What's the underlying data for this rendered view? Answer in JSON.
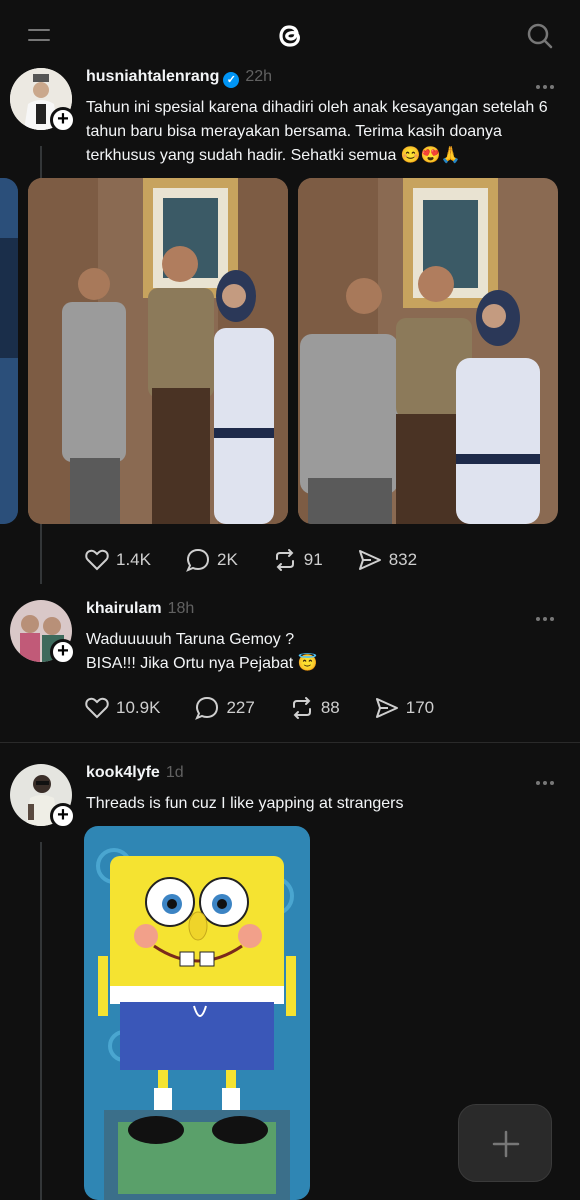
{
  "header": {
    "menu_icon": "menu-icon",
    "logo_icon": "threads-logo-icon",
    "search_icon": "search-icon"
  },
  "posts": [
    {
      "username": "husniahtalenrang",
      "verified": true,
      "time": "22h",
      "text": "Tahun ini spesial karena dihadiri oleh anak kesayangan setelah 6 tahun baru bisa merayakan bersama. Terima kasih doanya terkhusus yang sudah hadir. Sehatki semua 😊😍🙏",
      "images": [
        "family-photo-cadet-1",
        "family-photo-cadet-2"
      ],
      "likes": "1.4K",
      "replies": "2K",
      "reposts": "91",
      "shares": "832"
    },
    {
      "username": "khairulam",
      "time": "18h",
      "text_line1": "Waduuuuuh Taruna Gemoy ?",
      "text_line2": "BISA!!! Jika Ortu nya Pejabat 😇",
      "likes": "10.9K",
      "replies": "227",
      "reposts": "88",
      "shares": "170"
    },
    {
      "username": "kook4lyfe",
      "time": "1d",
      "text": "Threads is fun cuz I like yapping at strangers",
      "images": [
        "spongebob-image"
      ]
    }
  ],
  "colors": {
    "background": "#101010",
    "text": "#f3f5f7",
    "muted": "#616161",
    "verified": "#0095f6"
  },
  "fab": {
    "icon": "plus-icon"
  }
}
